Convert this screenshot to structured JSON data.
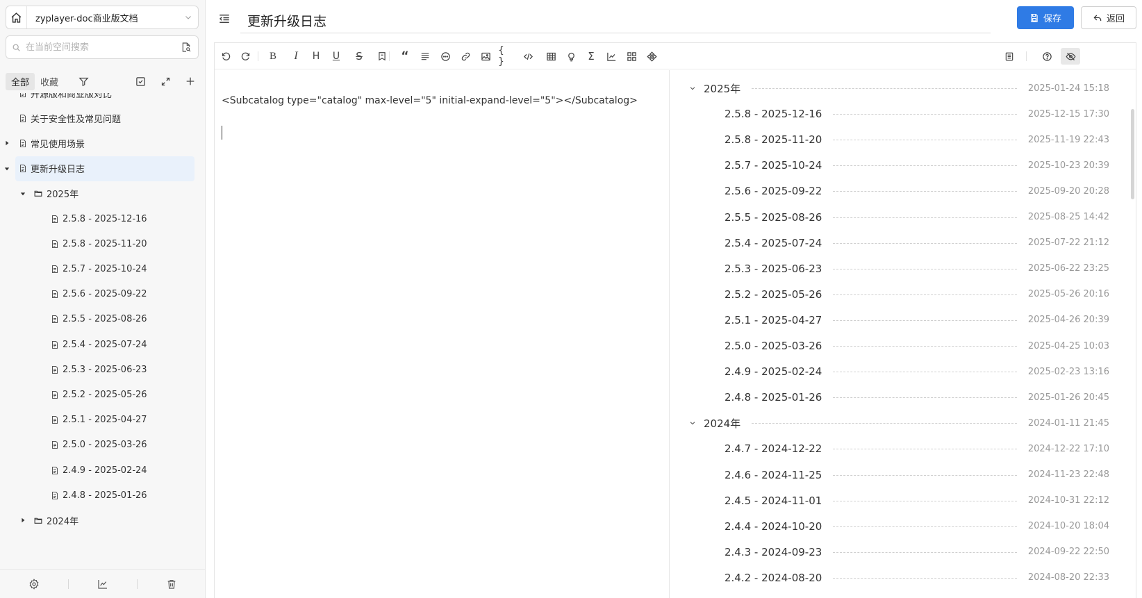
{
  "space": {
    "name": "zyplayer-doc商业版文档"
  },
  "search": {
    "placeholder": "在当前空间搜索"
  },
  "sidebar_tabs": {
    "all": "全部",
    "favorites": "收藏"
  },
  "tree": [
    {
      "label": "开源版和商业版对比",
      "indent": 0,
      "arrow": "none",
      "icon": "doc"
    },
    {
      "label": "关于安全性及常见问题",
      "indent": 0,
      "arrow": "none",
      "icon": "doc"
    },
    {
      "label": "常见使用场景",
      "indent": 0,
      "arrow": "right",
      "icon": "doc"
    },
    {
      "label": "更新升级日志",
      "indent": 0,
      "arrow": "down",
      "icon": "doc",
      "selected": true
    },
    {
      "label": "2025年",
      "indent": 1,
      "arrow": "down",
      "icon": "folder"
    },
    {
      "label": "2.5.8 - 2025-12-16",
      "indent": 2,
      "arrow": "none",
      "icon": "doc"
    },
    {
      "label": "2.5.8 - 2025-11-20",
      "indent": 2,
      "arrow": "none",
      "icon": "doc"
    },
    {
      "label": "2.5.7 - 2025-10-24",
      "indent": 2,
      "arrow": "none",
      "icon": "doc"
    },
    {
      "label": "2.5.6 - 2025-09-22",
      "indent": 2,
      "arrow": "none",
      "icon": "doc"
    },
    {
      "label": "2.5.5 - 2025-08-26",
      "indent": 2,
      "arrow": "none",
      "icon": "doc"
    },
    {
      "label": "2.5.4 - 2025-07-24",
      "indent": 2,
      "arrow": "none",
      "icon": "doc"
    },
    {
      "label": "2.5.3 - 2025-06-23",
      "indent": 2,
      "arrow": "none",
      "icon": "doc"
    },
    {
      "label": "2.5.2 - 2025-05-26",
      "indent": 2,
      "arrow": "none",
      "icon": "doc"
    },
    {
      "label": "2.5.1 - 2025-04-27",
      "indent": 2,
      "arrow": "none",
      "icon": "doc"
    },
    {
      "label": "2.5.0 - 2025-03-26",
      "indent": 2,
      "arrow": "none",
      "icon": "doc"
    },
    {
      "label": "2.4.9 - 2025-02-24",
      "indent": 2,
      "arrow": "none",
      "icon": "doc"
    },
    {
      "label": "2.4.8 - 2025-01-26",
      "indent": 2,
      "arrow": "none",
      "icon": "doc"
    },
    {
      "label": "2024年",
      "indent": 1,
      "arrow": "right",
      "icon": "folder"
    }
  ],
  "header": {
    "title": "更新升级日志",
    "save_label": "保存",
    "back_label": "返回"
  },
  "toolbar_icons": [
    "undo-icon",
    "redo-icon",
    "bold-icon",
    "italic-icon",
    "heading-icon",
    "underline-icon",
    "strikethrough-icon",
    "bookmark-icon",
    "quote-icon",
    "align-icon",
    "emoji-icon",
    "link-icon",
    "image-icon",
    "code-block-icon",
    "inline-code-icon",
    "table-icon",
    "bulb-icon",
    "formula-icon",
    "chart-icon",
    "grid-icon",
    "diagram-icon",
    "outline-icon",
    "help-icon",
    "preview-toggle-icon"
  ],
  "editor": {
    "content": "<Subcatalog type=\"catalog\" max-level=\"5\" initial-expand-level=\"5\"></Subcatalog>"
  },
  "preview": [
    {
      "label": "2025年",
      "date": "2025-01-24 15:18",
      "level": 0
    },
    {
      "label": "2.5.8 - 2025-12-16",
      "date": "2025-12-15 17:30",
      "level": 1
    },
    {
      "label": "2.5.8 - 2025-11-20",
      "date": "2025-11-19 22:43",
      "level": 1
    },
    {
      "label": "2.5.7 - 2025-10-24",
      "date": "2025-10-23 20:39",
      "level": 1
    },
    {
      "label": "2.5.6 - 2025-09-22",
      "date": "2025-09-20 20:28",
      "level": 1
    },
    {
      "label": "2.5.5 - 2025-08-26",
      "date": "2025-08-25 14:42",
      "level": 1
    },
    {
      "label": "2.5.4 - 2025-07-24",
      "date": "2025-07-22 21:12",
      "level": 1
    },
    {
      "label": "2.5.3 - 2025-06-23",
      "date": "2025-06-22 23:25",
      "level": 1
    },
    {
      "label": "2.5.2 - 2025-05-26",
      "date": "2025-05-26 20:16",
      "level": 1
    },
    {
      "label": "2.5.1 - 2025-04-27",
      "date": "2025-04-26 20:39",
      "level": 1
    },
    {
      "label": "2.5.0 - 2025-03-26",
      "date": "2025-04-25 10:03",
      "level": 1
    },
    {
      "label": "2.4.9 - 2025-02-24",
      "date": "2025-02-23 13:16",
      "level": 1
    },
    {
      "label": "2.4.8 - 2025-01-26",
      "date": "2025-01-26 20:45",
      "level": 1
    },
    {
      "label": "2024年",
      "date": "2024-01-11 21:45",
      "level": 0
    },
    {
      "label": "2.4.7 - 2024-12-22",
      "date": "2024-12-22 17:10",
      "level": 1
    },
    {
      "label": "2.4.6 - 2024-11-25",
      "date": "2024-11-23 22:48",
      "level": 1
    },
    {
      "label": "2.4.5 - 2024-11-01",
      "date": "2024-10-31 22:12",
      "level": 1
    },
    {
      "label": "2.4.4 - 2024-10-20",
      "date": "2024-10-20 18:04",
      "level": 1
    },
    {
      "label": "2.4.3 - 2024-09-23",
      "date": "2024-09-22 22:50",
      "level": 1
    },
    {
      "label": "2.4.2 - 2024-08-20",
      "date": "2024-08-20 22:33",
      "level": 1
    }
  ],
  "colors": {
    "accent": "#2f7be5",
    "selected_bg": "#e9f1fb",
    "sidebar_bg": "#f7f7f7"
  }
}
